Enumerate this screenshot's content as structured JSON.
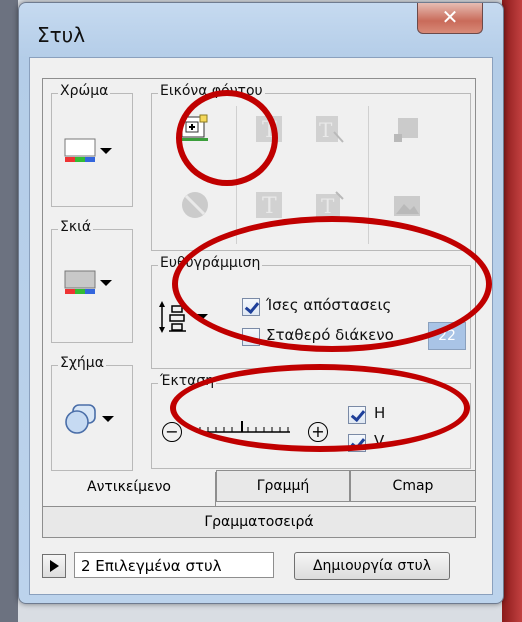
{
  "window": {
    "title": "Στυλ",
    "close_glyph": "✕"
  },
  "groups": {
    "color": {
      "label": "Χρώμα"
    },
    "shadow": {
      "label": "Σκιά"
    },
    "shape": {
      "label": "Σχήμα"
    },
    "background_image": {
      "label": "Εικόνα φόντου"
    },
    "alignment": {
      "label": "Ευθυγράμμιση"
    },
    "extent": {
      "label": "Έκταση"
    }
  },
  "alignment": {
    "equal_spacing": {
      "label": "Ίσες απόστασεις",
      "checked": true
    },
    "fixed_gap": {
      "label": "Σταθερό διάκενο",
      "checked": false,
      "value": "22"
    }
  },
  "extent": {
    "minus": "−",
    "plus": "+",
    "h": {
      "label": "H",
      "checked": true
    },
    "v": {
      "label": "V",
      "checked": true
    }
  },
  "tabs": [
    {
      "label": "Αντικείμενο",
      "active": true
    },
    {
      "label": "Γραμμή",
      "active": false
    },
    {
      "label": "Cmap",
      "active": false
    },
    {
      "label": "Γραμματοσειρά",
      "active": false
    }
  ],
  "footer": {
    "selected_styles": "2 Επιλεγμένα στυλ",
    "create_style_button": "Δημιουργία στυλ"
  },
  "icons": {
    "arrow": "play-icon",
    "bg_image_set": "insert-background-image-icon",
    "bg_image_remove": "no-image-icon"
  }
}
